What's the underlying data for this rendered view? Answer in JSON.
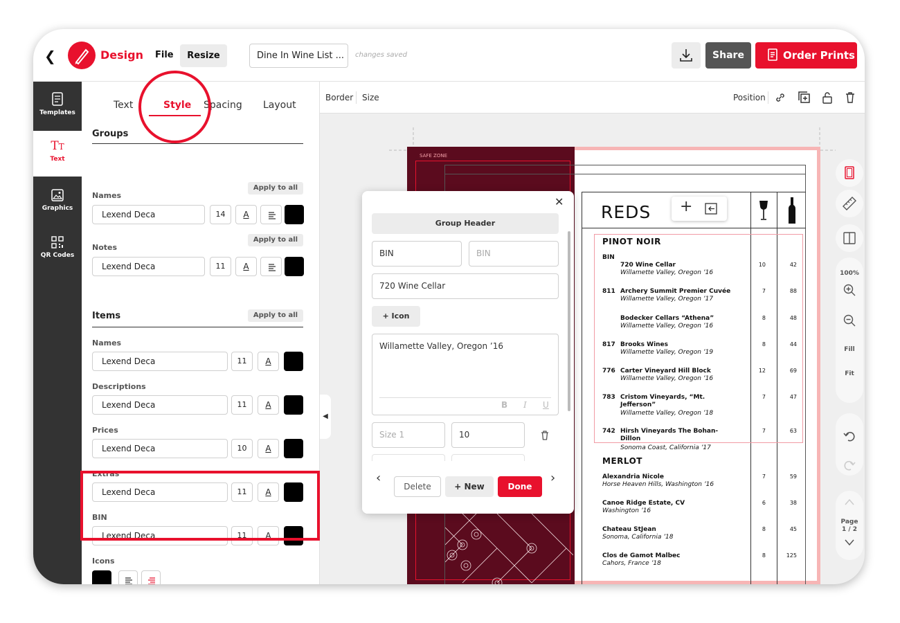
{
  "topbar": {
    "brand": "Design",
    "file_label": "File",
    "resize_label": "Resize",
    "document_title": "Dine In Wine List ...",
    "save_status": "changes saved",
    "share_label": "Share",
    "order_label": "Order Prints"
  },
  "rail": {
    "items": [
      {
        "label": "Templates",
        "icon": "templates-icon"
      },
      {
        "label": "Text",
        "icon": "text-icon"
      },
      {
        "label": "Graphics",
        "icon": "graphics-icon"
      },
      {
        "label": "QR Codes",
        "icon": "qr-code-icon"
      }
    ]
  },
  "panel": {
    "tabs": [
      "Text",
      "Style",
      "Spacing",
      "Layout"
    ],
    "active_tab": "Style",
    "apply_all": "Apply to all",
    "groups": {
      "heading": "Groups",
      "names": {
        "label": "Names",
        "font": "Lexend Deca",
        "size": "14",
        "color": "#000000"
      },
      "notes": {
        "label": "Notes",
        "font": "Lexend Deca",
        "size": "11",
        "color": "#000000"
      }
    },
    "items": {
      "heading": "Items",
      "names": {
        "label": "Names",
        "font": "Lexend Deca",
        "size": "11"
      },
      "descriptions": {
        "label": "Descriptions",
        "font": "Lexend Deca",
        "size": "11"
      },
      "prices": {
        "label": "Prices",
        "font": "Lexend Deca",
        "size": "10"
      },
      "extras": {
        "label": "Extras",
        "font": "Lexend Deca",
        "size": "11"
      },
      "bin": {
        "label": "BIN",
        "font": "Lexend Deca",
        "size": "11"
      },
      "icons": {
        "label": "Icons"
      }
    },
    "a_label": "A"
  },
  "canvas_toolbar": {
    "border": "Border",
    "size": "Size",
    "position": "Position"
  },
  "right_rail": {
    "zoom": "100%",
    "fill": "Fill",
    "fit": "Fit",
    "page_label": "Page",
    "page_value": "1 / 2"
  },
  "popup": {
    "header_label": "Group Header",
    "bin_label_value": "BIN",
    "bin_placeholder": "BIN",
    "name_value": "720 Wine Cellar",
    "icon_label": "+ Icon",
    "description_value": "Willamette Valley, Oregon ’16",
    "size_placeholder": "Size 1",
    "size_value": "10",
    "delete_label": "Delete",
    "new_label": "+ New",
    "done_label": "Done"
  },
  "menu": {
    "safe_zone": "SAFE ZONE",
    "title": "REDS",
    "groups": [
      {
        "name": "PINOT NOIR",
        "bin_header": "BIN",
        "items": [
          {
            "bin": "",
            "name": "720 Wine Cellar",
            "desc": "Willamette Valley, Oregon ’16",
            "glass": "10",
            "bottle": "42"
          },
          {
            "bin": "811",
            "name": "Archery Summit Premier Cuvée",
            "desc": "Willamette Valley, Oregon ’17",
            "glass": "7",
            "bottle": "88"
          },
          {
            "bin": "",
            "name": "Bodecker Cellars “Athena”",
            "desc": "Willamette Valley, Oregon ’16",
            "glass": "8",
            "bottle": "48"
          },
          {
            "bin": "817",
            "name": "Brooks Wines",
            "desc": "Willamette Valley, Oregon ’19",
            "glass": "8",
            "bottle": "44"
          },
          {
            "bin": "776",
            "name": "Carter Vineyard Hill Block",
            "desc": "Willamette Valley, Oregon ’16",
            "glass": "12",
            "bottle": "69"
          },
          {
            "bin": "783",
            "name": "Cristom Vineyards, “Mt. Jefferson”",
            "desc": "Willamette Valley, Oregon ’18",
            "glass": "7",
            "bottle": "47"
          },
          {
            "bin": "742",
            "name": "Hirsh Vineyards The Bohan-Dillon",
            "desc": "Sonoma Coast, California ’17",
            "glass": "7",
            "bottle": "63"
          }
        ]
      },
      {
        "name": "MERLOT",
        "items": [
          {
            "bin": "",
            "name": "Alexandria Nicole",
            "desc": "Horse Heaven Hills, Washington ’16",
            "glass": "7",
            "bottle": "59"
          },
          {
            "bin": "",
            "name": "Canoe Ridge Estate, CV",
            "desc": "Washington ’16",
            "glass": "6",
            "bottle": "38"
          },
          {
            "bin": "",
            "name": "Chateau StJean",
            "desc": "Sonoma, California ’18",
            "glass": "8",
            "bottle": "45"
          },
          {
            "bin": "",
            "name": "Clos de Gamot Malbec",
            "desc": "Cahors, France ’18",
            "glass": "8",
            "bottle": "125"
          }
        ]
      }
    ]
  },
  "colors": {
    "accent": "#e8112d",
    "wine": "#5b0b1e",
    "dark_rail": "#333333"
  }
}
